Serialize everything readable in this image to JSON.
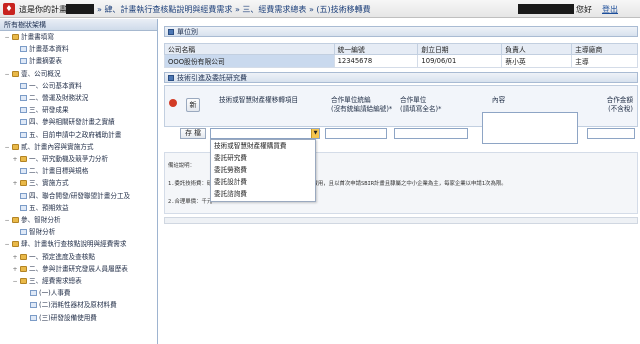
{
  "topbar": {
    "plan_label": "這是你的計畫名稱",
    "breadcrumb": "» 肆、計畫執行查核點說明與經費需求 » 三、經費需求總表 » (五)技術移轉費",
    "greeting": "您好",
    "logout": "登出"
  },
  "tree": {
    "header": "所有樹狀架構",
    "items": [
      {
        "label": "計畫書填寫",
        "type": "folder",
        "toggle": "−"
      },
      {
        "label": "計畫基本資料",
        "type": "page",
        "toggle": ""
      },
      {
        "label": "計畫摘要表",
        "type": "page",
        "toggle": ""
      },
      {
        "label": "壹、公司概況",
        "type": "folder",
        "toggle": "−"
      },
      {
        "label": "一、公司基本資料",
        "type": "page",
        "toggle": ""
      },
      {
        "label": "二、營運及財務狀況",
        "type": "page",
        "toggle": ""
      },
      {
        "label": "三、研發成果",
        "type": "page",
        "toggle": ""
      },
      {
        "label": "四、參與相關研發計畫之實績",
        "type": "page",
        "toggle": ""
      },
      {
        "label": "五、目前申請中之政府補助計畫",
        "type": "page",
        "toggle": ""
      },
      {
        "label": "貳、計畫內容與實施方式",
        "type": "folder",
        "toggle": "−"
      },
      {
        "label": "一、研究動機及競爭力分析",
        "type": "folder",
        "toggle": "+"
      },
      {
        "label": "二、計畫目標與規格",
        "type": "page",
        "toggle": ""
      },
      {
        "label": "三、實施方式",
        "type": "folder",
        "toggle": "+"
      },
      {
        "label": "四、聯合開發/研發聯盟計畫分工及",
        "type": "page",
        "toggle": ""
      },
      {
        "label": "五、預期效益",
        "type": "page",
        "toggle": ""
      },
      {
        "label": "參、智財分析",
        "type": "folder",
        "toggle": "−"
      },
      {
        "label": "智財分析",
        "type": "page",
        "toggle": ""
      },
      {
        "label": "肆、計畫執行查核點說明與經費需求",
        "type": "folder",
        "toggle": "−"
      },
      {
        "label": "一、預定進度及查核點",
        "type": "folder",
        "toggle": "+"
      },
      {
        "label": "二、參與計畫研究發展人員履歷表",
        "type": "folder",
        "toggle": "+"
      },
      {
        "label": "三、經費需求總表",
        "type": "folder",
        "toggle": "−"
      },
      {
        "label": "(一)人事費",
        "type": "page",
        "toggle": ""
      },
      {
        "label": "(二)消耗性器材及原材料費",
        "type": "page",
        "toggle": ""
      },
      {
        "label": "(三)研發設備使用費",
        "type": "page",
        "toggle": ""
      }
    ]
  },
  "unit": {
    "section_title": "單位別",
    "headers": [
      "公司名稱",
      "統一編號",
      "創立日期",
      "負責人",
      "主導廠商"
    ],
    "row": [
      "OOO股份有限公司",
      "12345678",
      "109/06/01",
      "蔡小英",
      "主導"
    ]
  },
  "tech": {
    "section_title": "技術引進及委託研究費",
    "add_label": "新",
    "headers": {
      "item": "技術或智慧財產權移轉項目",
      "unit": "合作單位統編\n(沒有統編請給編號)*",
      "unit_name": "合作單位\n(請填寫全名)*",
      "content": "內容",
      "amount": "合作金額\n(不含稅)"
    },
    "save_label": "存 檔",
    "dropdown_options": [
      "技術或智慧財產權購買費",
      "委託研究費",
      "委託勞務費",
      "委託設計費",
      "委託諮詢費"
    ]
  },
  "notes": {
    "title": "備註說明：",
    "line1": "1.委託技術費：研                        工業技術研究院委託技術開發費用等相關費用，且以首次申請SBIR計畫且隸屬之中小企業為主，每家企業以申請1次為限。",
    "line2": "2.合理單價：千元"
  }
}
